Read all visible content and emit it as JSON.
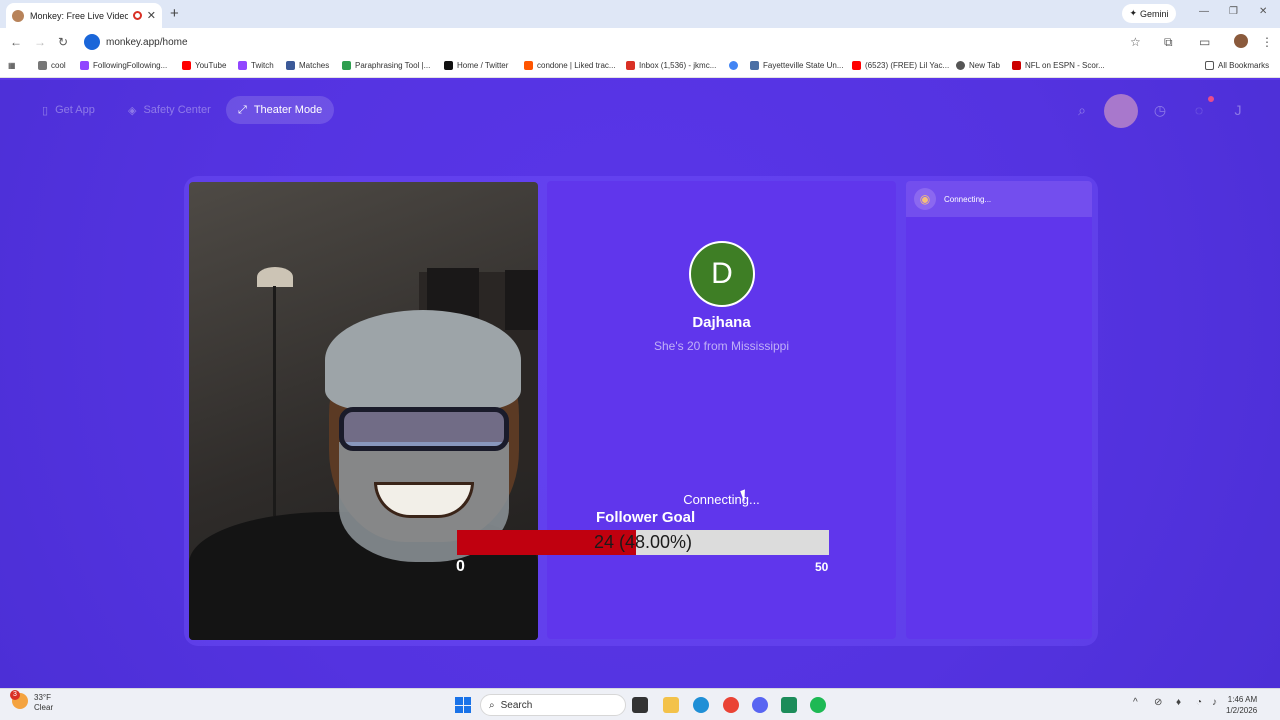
{
  "browser": {
    "tab_title": "Monkey: Free Live Video Ch",
    "new_tab_glyph": "+",
    "gemini_label": "Gemini",
    "url": "monkey.app/home",
    "bookmarks": [
      {
        "label": "cool",
        "color": "#777777"
      },
      {
        "label": "FollowingFollowing...",
        "color": "#9146ff"
      },
      {
        "label": "YouTube",
        "color": "#ff0000"
      },
      {
        "label": "Twitch",
        "color": "#9146ff"
      },
      {
        "label": "Matches",
        "color": "#3b5998"
      },
      {
        "label": "Paraphrasing Tool |...",
        "color": "#2e9e4f"
      },
      {
        "label": "Home / Twitter",
        "color": "#111111"
      },
      {
        "label": "condone | Liked trac...",
        "color": "#ff5500"
      },
      {
        "label": "Inbox (1,536) - jkmc...",
        "color": "#d93025"
      },
      {
        "label": "",
        "color": "#4285f4"
      },
      {
        "label": "Fayetteville State Un...",
        "color": "#4a6fa5"
      },
      {
        "label": "(6523) (FREE) Lil Yac...",
        "color": "#ff0000"
      },
      {
        "label": "New Tab",
        "color": "#555555"
      },
      {
        "label": "NFL on ESPN - Scor...",
        "color": "#cc0000"
      }
    ],
    "all_bookmarks": "All Bookmarks"
  },
  "nav": {
    "get_app": "Get App",
    "safety_center": "Safety Center",
    "theater_mode": "Theater Mode",
    "profile_initial": "J"
  },
  "match": {
    "avatar_initial": "D",
    "name": "Dajhana",
    "description": "She's 20 from Mississippi",
    "connecting": "Connecting..."
  },
  "chat": {
    "status": "Connecting..."
  },
  "follower_goal": {
    "title": "Follower Goal",
    "current": 24,
    "text": "24 (48.00%)",
    "progress_fraction": 0.48,
    "min": "0",
    "max": "50"
  },
  "taskbar": {
    "weather_temp": "33°F",
    "weather_desc": "Clear",
    "weather_badge": "3",
    "search_placeholder": "Search",
    "time": "1:46 AM",
    "date": "1/2/2026"
  }
}
